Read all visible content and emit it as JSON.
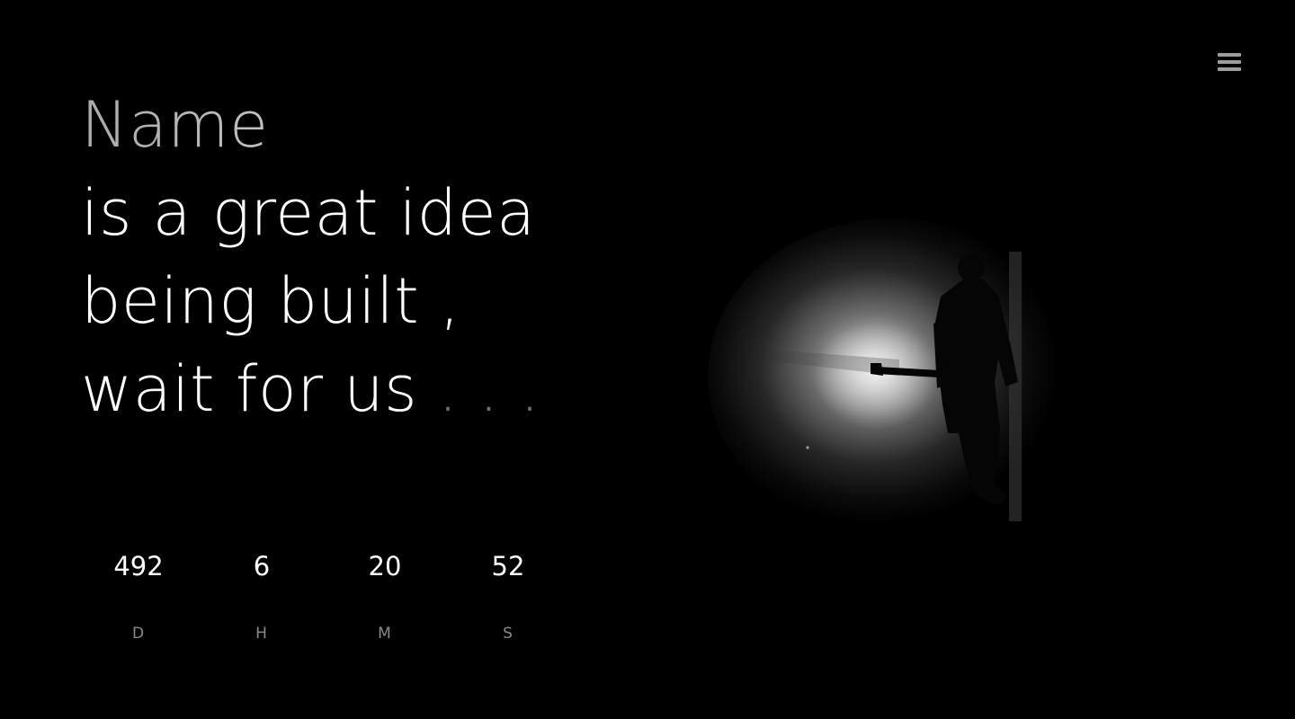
{
  "headline": {
    "name": "Name",
    "line2": "is a great idea",
    "line3": "being built ,",
    "line4": "wait for us",
    "ellipsis": " . . ."
  },
  "menu": {
    "icon": "hamburger-menu-icon"
  },
  "countdown": [
    {
      "value": "492",
      "label": "D"
    },
    {
      "value": "6",
      "label": "H"
    },
    {
      "value": "20",
      "label": "M"
    },
    {
      "value": "52",
      "label": "S"
    }
  ],
  "hero": {
    "subject": "guitarist-silhouette-image",
    "colors": {
      "background": "#000000",
      "spotlight": "#d9d9d9"
    }
  }
}
